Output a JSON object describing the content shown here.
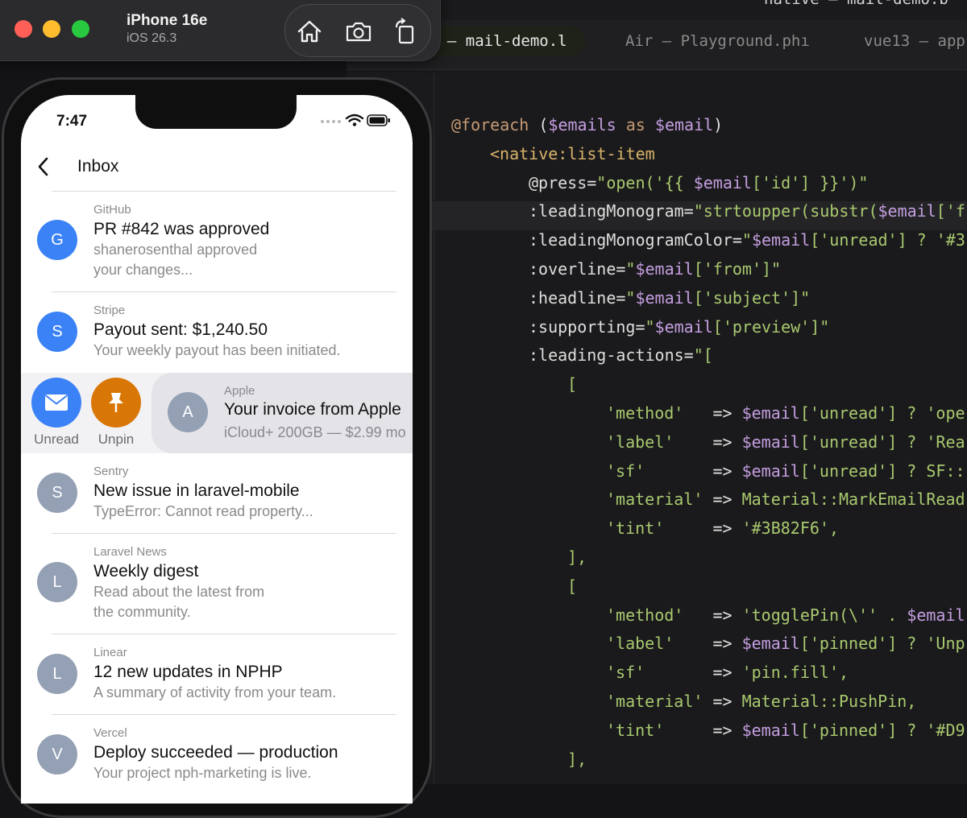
{
  "simulator": {
    "device_name": "iPhone 16e",
    "os_version": "iOS 26.3",
    "tools": [
      {
        "icon": "home-icon"
      },
      {
        "icon": "camera-icon"
      },
      {
        "icon": "rotate-icon"
      }
    ]
  },
  "editor": {
    "window_title": "native — mail-demo.b",
    "tabs": [
      {
        "label": "e — mail-demo.l",
        "active": true
      },
      {
        "label": "Air — Playground.phı",
        "active": false
      },
      {
        "label": "vue13 — app.",
        "active": false
      }
    ]
  },
  "phone": {
    "time": "7:47",
    "nav_title": "Inbox",
    "emails": [
      {
        "from": "GitHub",
        "monogram": "G",
        "subject": "PR #842 was approved",
        "preview": "shanerosenthal approved\nyour changes...",
        "unread": true
      },
      {
        "from": "Stripe",
        "monogram": "S",
        "subject": "Payout sent: $1,240.50",
        "preview": "Your weekly payout has been initiated.",
        "unread": true
      },
      {
        "from": "Sentry",
        "monogram": "S",
        "subject": "New issue in laravel-mobile",
        "preview": "TypeError: Cannot read property...",
        "unread": false
      },
      {
        "from": "Laravel News",
        "monogram": "L",
        "subject": "Weekly digest",
        "preview": "Read about the latest from\nthe community.",
        "unread": false
      },
      {
        "from": "Linear",
        "monogram": "L",
        "subject": "12 new updates in NPHP",
        "preview": "A summary of activity from your team.",
        "unread": false
      },
      {
        "from": "Vercel",
        "monogram": "V",
        "subject": "Deploy succeeded — production",
        "preview": "Your project nph-marketing is live.",
        "unread": false
      }
    ],
    "swiped_email": {
      "from": "Apple",
      "monogram": "A",
      "subject": "Your invoice from Apple",
      "preview": "iCloud+ 200GB — $2.99 mo"
    },
    "swipe_actions": [
      {
        "label": "Unread",
        "color": "#3B82F6",
        "icon": "envelope-icon"
      },
      {
        "label": "Unpin",
        "color": "#D97706",
        "icon": "pin-icon"
      }
    ]
  },
  "colors": {
    "unread_monogram": "#3B82F6",
    "read_monogram": "#94A0B4"
  }
}
